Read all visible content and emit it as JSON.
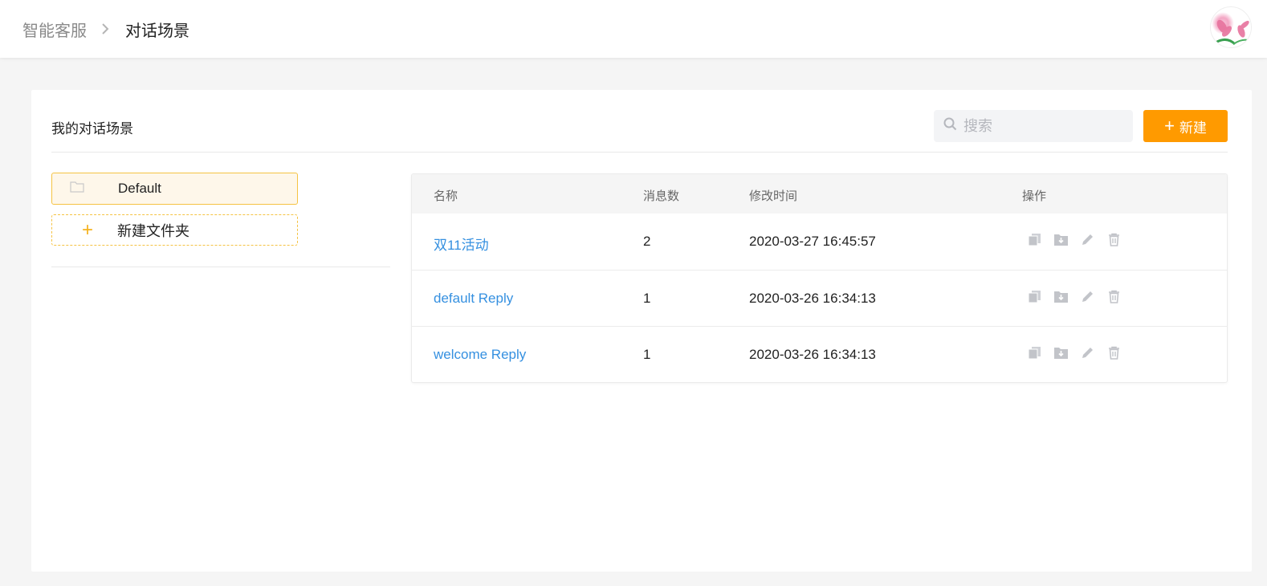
{
  "breadcrumb": {
    "root": "智能客服",
    "current": "对话场景"
  },
  "card": {
    "title": "我的对话场景",
    "search_placeholder": "搜索",
    "new_button": "新建"
  },
  "folders": {
    "items": [
      {
        "label": "Default"
      }
    ],
    "new_folder_label": "新建文件夹"
  },
  "table": {
    "headers": [
      "名称",
      "消息数",
      "修改时间",
      "操作"
    ],
    "rows": [
      {
        "name": "双11活动",
        "count": "2",
        "modified": "2020-03-27 16:45:57"
      },
      {
        "name": "default Reply",
        "count": "1",
        "modified": "2020-03-26 16:34:13"
      },
      {
        "name": "welcome Reply",
        "count": "1",
        "modified": "2020-03-26 16:34:13"
      }
    ],
    "action_icons": [
      "copy-icon",
      "move-to-folder-icon",
      "edit-icon",
      "delete-icon"
    ]
  },
  "colors": {
    "accent": "#ff9a00",
    "folder_border": "#f5c343",
    "link": "#3590e0"
  }
}
